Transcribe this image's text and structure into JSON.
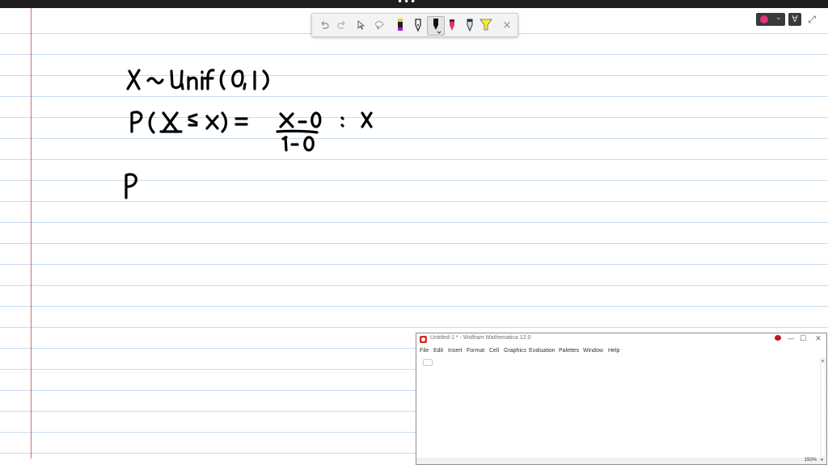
{
  "window": {
    "menu_dots": "•••"
  },
  "pen_toolbar": {
    "tools": [
      {
        "name": "undo-icon"
      },
      {
        "name": "redo-icon"
      },
      {
        "name": "select-pointer-icon"
      },
      {
        "name": "lasso-icon"
      },
      {
        "name": "pen-yellow-purple",
        "color": "#a020c0"
      },
      {
        "name": "pen-black-fine",
        "color": "#000000"
      },
      {
        "name": "pen-black-selected",
        "color": "#000000"
      },
      {
        "name": "pen-red",
        "color": "#e0357a"
      },
      {
        "name": "pen-blue",
        "color": "#4a7ac8"
      },
      {
        "name": "highlighter-yellow",
        "color": "#f7ea3a"
      },
      {
        "name": "close-icon"
      }
    ],
    "close_label": "×"
  },
  "right_controls": {
    "ink_color": "#e0357a",
    "ruler_label": "∀",
    "expand_label": "⤢"
  },
  "handwriting": {
    "line1": "X ~ Unif (0, 1)",
    "line2": "P(X ≤ x) = (x - 0)/(1 - 0) = x",
    "line3": "P",
    "ink_color": "#000000"
  },
  "mathematica": {
    "title": "Untitled-1 * - Wolfram Mathematica 12.0",
    "menu": [
      "File",
      "Edit",
      "Insert",
      "Format",
      "Cell",
      "Graphics",
      "Evaluation",
      "Palettes",
      "Window",
      "Help"
    ],
    "zoom": "150%",
    "accent": "#d72b26"
  }
}
